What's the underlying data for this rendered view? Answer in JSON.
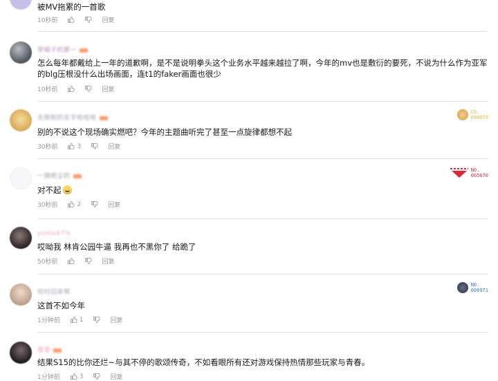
{
  "comments": [
    {
      "username": "",
      "text": "被MV拖累的一首歌",
      "time": "10秒前",
      "likes": "",
      "reply": "回复",
      "avatar_color": "#c7c0e6"
    },
    {
      "username": "草帽子的那一",
      "text": "怎么每年都戴给上一年的道歉啊，是不是说明拳头这个业务水平越来越拉了啊，今年的mv也是敷衍的要死，不说为什么作为亚军的blg压根没什么出场画面，连t1的faker画面也很少",
      "time": "10秒前",
      "likes": "",
      "reply": "回复",
      "avatar_color": "#6a6f76"
    },
    {
      "username": "无限制的名字哈哈哈",
      "text": "别的不说这个现场确实燃吧？今年的主题曲听完了甚至一点旋律都想不起",
      "time": "30秒前",
      "likes": "3",
      "reply": "回复",
      "avatar_color": "#e7c27a",
      "badge": {
        "label": "CO.",
        "number": "000079",
        "color": "#e8b23a"
      }
    },
    {
      "username": "一骑绝尘的",
      "text": "对不起",
      "emoji": "crying-face",
      "time": "30秒前",
      "likes": "2",
      "reply": "回复",
      "avatar_color": "#f4f4f6",
      "badge": {
        "label": "NO.",
        "number": "005670",
        "color": "#e1253b"
      }
    },
    {
      "username": "yomo47%",
      "text": "哎呦我 林肯公园牛逼 我再也不黑你了 给跪了",
      "time": "50秒前",
      "likes": "",
      "reply": "回复",
      "avatar_color": "#3a2f33"
    },
    {
      "username": "何时回来啊",
      "text": "这首不如今年",
      "time": "1分钟前",
      "likes": "1",
      "reply": "回复",
      "avatar_color": "#dcc6b4",
      "badge": {
        "label": "NO.",
        "number": "008971",
        "color": "#2f7ad6"
      }
    },
    {
      "username": "夜里",
      "text": "结果S15的比你还烂~与其不停的歌颂传奇，不如看眼所有还对游戏保持热情那些玩家与青春。",
      "time": "1分钟前",
      "likes": "3",
      "reply": "回复",
      "avatar_color": "#2e2a30"
    }
  ],
  "colors": {
    "text": "#18191c",
    "meta": "#9499a0",
    "divider": "#e3e5e7",
    "username": "#c8a0d0"
  },
  "icons": [
    "thumbs-up-icon",
    "thumbs-down-icon"
  ]
}
